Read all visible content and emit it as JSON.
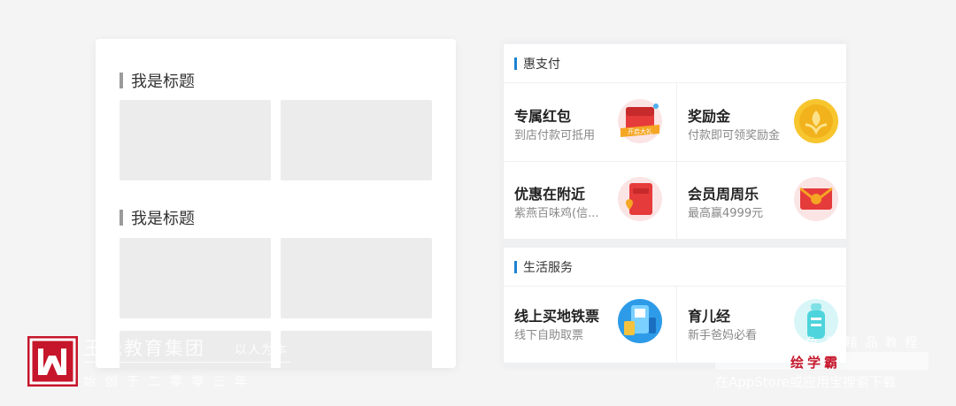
{
  "wireframe": {
    "title_1": "我是标题",
    "title_2": "我是标题"
  },
  "sections": [
    {
      "title": "惠支付",
      "items": [
        {
          "title": "专属红包",
          "subtitle": "到店付款可抵用",
          "icon": "red-envelope-icon",
          "badge": "开启大礼"
        },
        {
          "title": "奖励金",
          "subtitle": "付款即可领奖励金",
          "icon": "gold-coin-icon"
        },
        {
          "title": "优惠在附近",
          "subtitle": "紫燕百味鸡(信...",
          "icon": "red-ticket-location-icon"
        },
        {
          "title": "会员周周乐",
          "subtitle": "最高赢4999元",
          "icon": "red-gift-envelope-icon"
        }
      ]
    },
    {
      "title": "生活服务",
      "items": [
        {
          "title": "线上买地铁票",
          "subtitle": "线下自助取票",
          "icon": "subway-ticket-icon"
        },
        {
          "title": "育儿经",
          "subtitle": "新手爸妈必看",
          "icon": "baby-bottle-icon"
        }
      ]
    }
  ],
  "watermark": {
    "company": "王氏教育集团",
    "slogan": "以人为本",
    "since": "始 创 于 二 零 零 三 年",
    "right_top": "免 费 精 品 教 程",
    "brand": "绘学霸",
    "right_bottom": "在AppStore或应用宝搜索下载"
  },
  "colors": {
    "accent": "#1b82d2",
    "watermark_red": "#c6162b"
  }
}
